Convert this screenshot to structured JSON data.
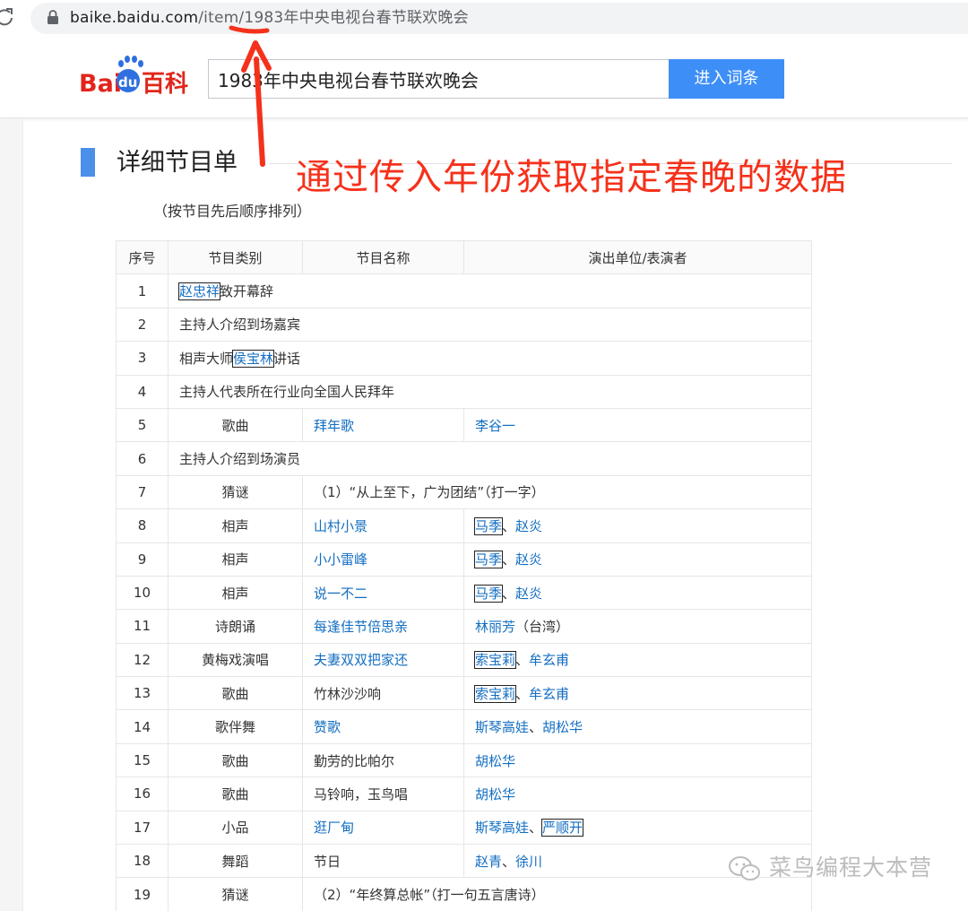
{
  "browser": {
    "url_host": "baike.baidu.com",
    "url_path": "/item/1983年中央电视台春节联欢晚会"
  },
  "header": {
    "logo_text": "Baidu百科",
    "search_value": "1983年中央电视台春节联欢晚会",
    "search_button": "进入词条",
    "brand_colors": {
      "red": "#e1251b",
      "blue": "#2f6fe0",
      "button": "#3e8ef7"
    }
  },
  "section": {
    "title": "详细节目单",
    "subtitle": "（按节目先后顺序排列）"
  },
  "annotation": {
    "text": "通过传入年份获取指定春晚的数据",
    "color": "#f5311b"
  },
  "table": {
    "headers": [
      "序号",
      "节目类别",
      "节目名称",
      "演出单位/表演者"
    ],
    "rows": [
      {
        "no": "1",
        "span": true,
        "parts": [
          {
            "t": "赵忠祥",
            "link": true,
            "box": true
          },
          {
            "t": "致开幕辞"
          }
        ]
      },
      {
        "no": "2",
        "span": true,
        "parts": [
          {
            "t": "主持人介绍到场嘉宾"
          }
        ]
      },
      {
        "no": "3",
        "span": true,
        "parts": [
          {
            "t": "相声大师"
          },
          {
            "t": "侯宝林",
            "link": true,
            "box": true
          },
          {
            "t": "讲话"
          }
        ]
      },
      {
        "no": "4",
        "span": true,
        "parts": [
          {
            "t": "主持人代表所在行业向全国人民拜年"
          }
        ]
      },
      {
        "no": "5",
        "category": "歌曲",
        "name": [
          {
            "t": "拜年歌",
            "link": true
          }
        ],
        "performer": [
          {
            "t": "李谷一",
            "link": true
          }
        ]
      },
      {
        "no": "6",
        "span": true,
        "parts": [
          {
            "t": "主持人介绍到场演员"
          }
        ]
      },
      {
        "no": "7",
        "category": "猜谜",
        "merged": "（1）“从上至下，广为团结”（打一字）"
      },
      {
        "no": "8",
        "category": "相声",
        "name": [
          {
            "t": "山村小景",
            "link": true
          }
        ],
        "performer": [
          {
            "t": "马季",
            "link": true,
            "box": true
          },
          {
            "t": "、"
          },
          {
            "t": "赵炎",
            "link": true
          }
        ]
      },
      {
        "no": "9",
        "category": "相声",
        "name": [
          {
            "t": "小小雷峰",
            "link": true
          }
        ],
        "performer": [
          {
            "t": "马季",
            "link": true,
            "box": true
          },
          {
            "t": "、"
          },
          {
            "t": "赵炎",
            "link": true
          }
        ]
      },
      {
        "no": "10",
        "category": "相声",
        "name": [
          {
            "t": "说一不二",
            "link": true
          }
        ],
        "performer": [
          {
            "t": "马季",
            "link": true,
            "box": true
          },
          {
            "t": "、"
          },
          {
            "t": "赵炎",
            "link": true
          }
        ]
      },
      {
        "no": "11",
        "category": "诗朗诵",
        "name": [
          {
            "t": "每逢佳节倍思亲",
            "link": true
          }
        ],
        "performer": [
          {
            "t": "林丽芳",
            "link": true
          },
          {
            "t": "（台湾）"
          }
        ]
      },
      {
        "no": "12",
        "category": "黄梅戏演唱",
        "name": [
          {
            "t": "夫妻双双把家还",
            "link": true
          }
        ],
        "performer": [
          {
            "t": "索宝莉",
            "link": true,
            "box": true
          },
          {
            "t": "、"
          },
          {
            "t": "牟玄甫",
            "link": true
          }
        ]
      },
      {
        "no": "13",
        "category": "歌曲",
        "name": [
          {
            "t": "竹林沙沙响"
          }
        ],
        "performer": [
          {
            "t": "索宝莉",
            "link": true,
            "box": true
          },
          {
            "t": "、"
          },
          {
            "t": "牟玄甫",
            "link": true
          }
        ]
      },
      {
        "no": "14",
        "category": "歌伴舞",
        "name": [
          {
            "t": "赞歌",
            "link": true
          }
        ],
        "performer": [
          {
            "t": "斯琴高娃",
            "link": true
          },
          {
            "t": "、"
          },
          {
            "t": "胡松华",
            "link": true
          }
        ]
      },
      {
        "no": "15",
        "category": "歌曲",
        "name": [
          {
            "t": "勤劳的比帕尔"
          }
        ],
        "performer": [
          {
            "t": "胡松华",
            "link": true
          }
        ]
      },
      {
        "no": "16",
        "category": "歌曲",
        "name": [
          {
            "t": "马铃响，玉鸟唱"
          }
        ],
        "performer": [
          {
            "t": "胡松华",
            "link": true
          }
        ]
      },
      {
        "no": "17",
        "category": "小品",
        "name": [
          {
            "t": "逛厂甸",
            "link": true
          }
        ],
        "performer": [
          {
            "t": "斯琴高娃",
            "link": true
          },
          {
            "t": "、"
          },
          {
            "t": "严顺开",
            "link": true,
            "box": true
          }
        ]
      },
      {
        "no": "18",
        "category": "舞蹈",
        "name": [
          {
            "t": "节日"
          }
        ],
        "performer": [
          {
            "t": "赵青",
            "link": true
          },
          {
            "t": "、"
          },
          {
            "t": "徐川",
            "link": true
          }
        ]
      },
      {
        "no": "19",
        "category": "猜谜",
        "merged": "（2）“年终算总帐”（打一句五言唐诗）"
      }
    ]
  },
  "watermark": {
    "text": "菜鸟编程大本营",
    "icon": "wechat-icon"
  }
}
